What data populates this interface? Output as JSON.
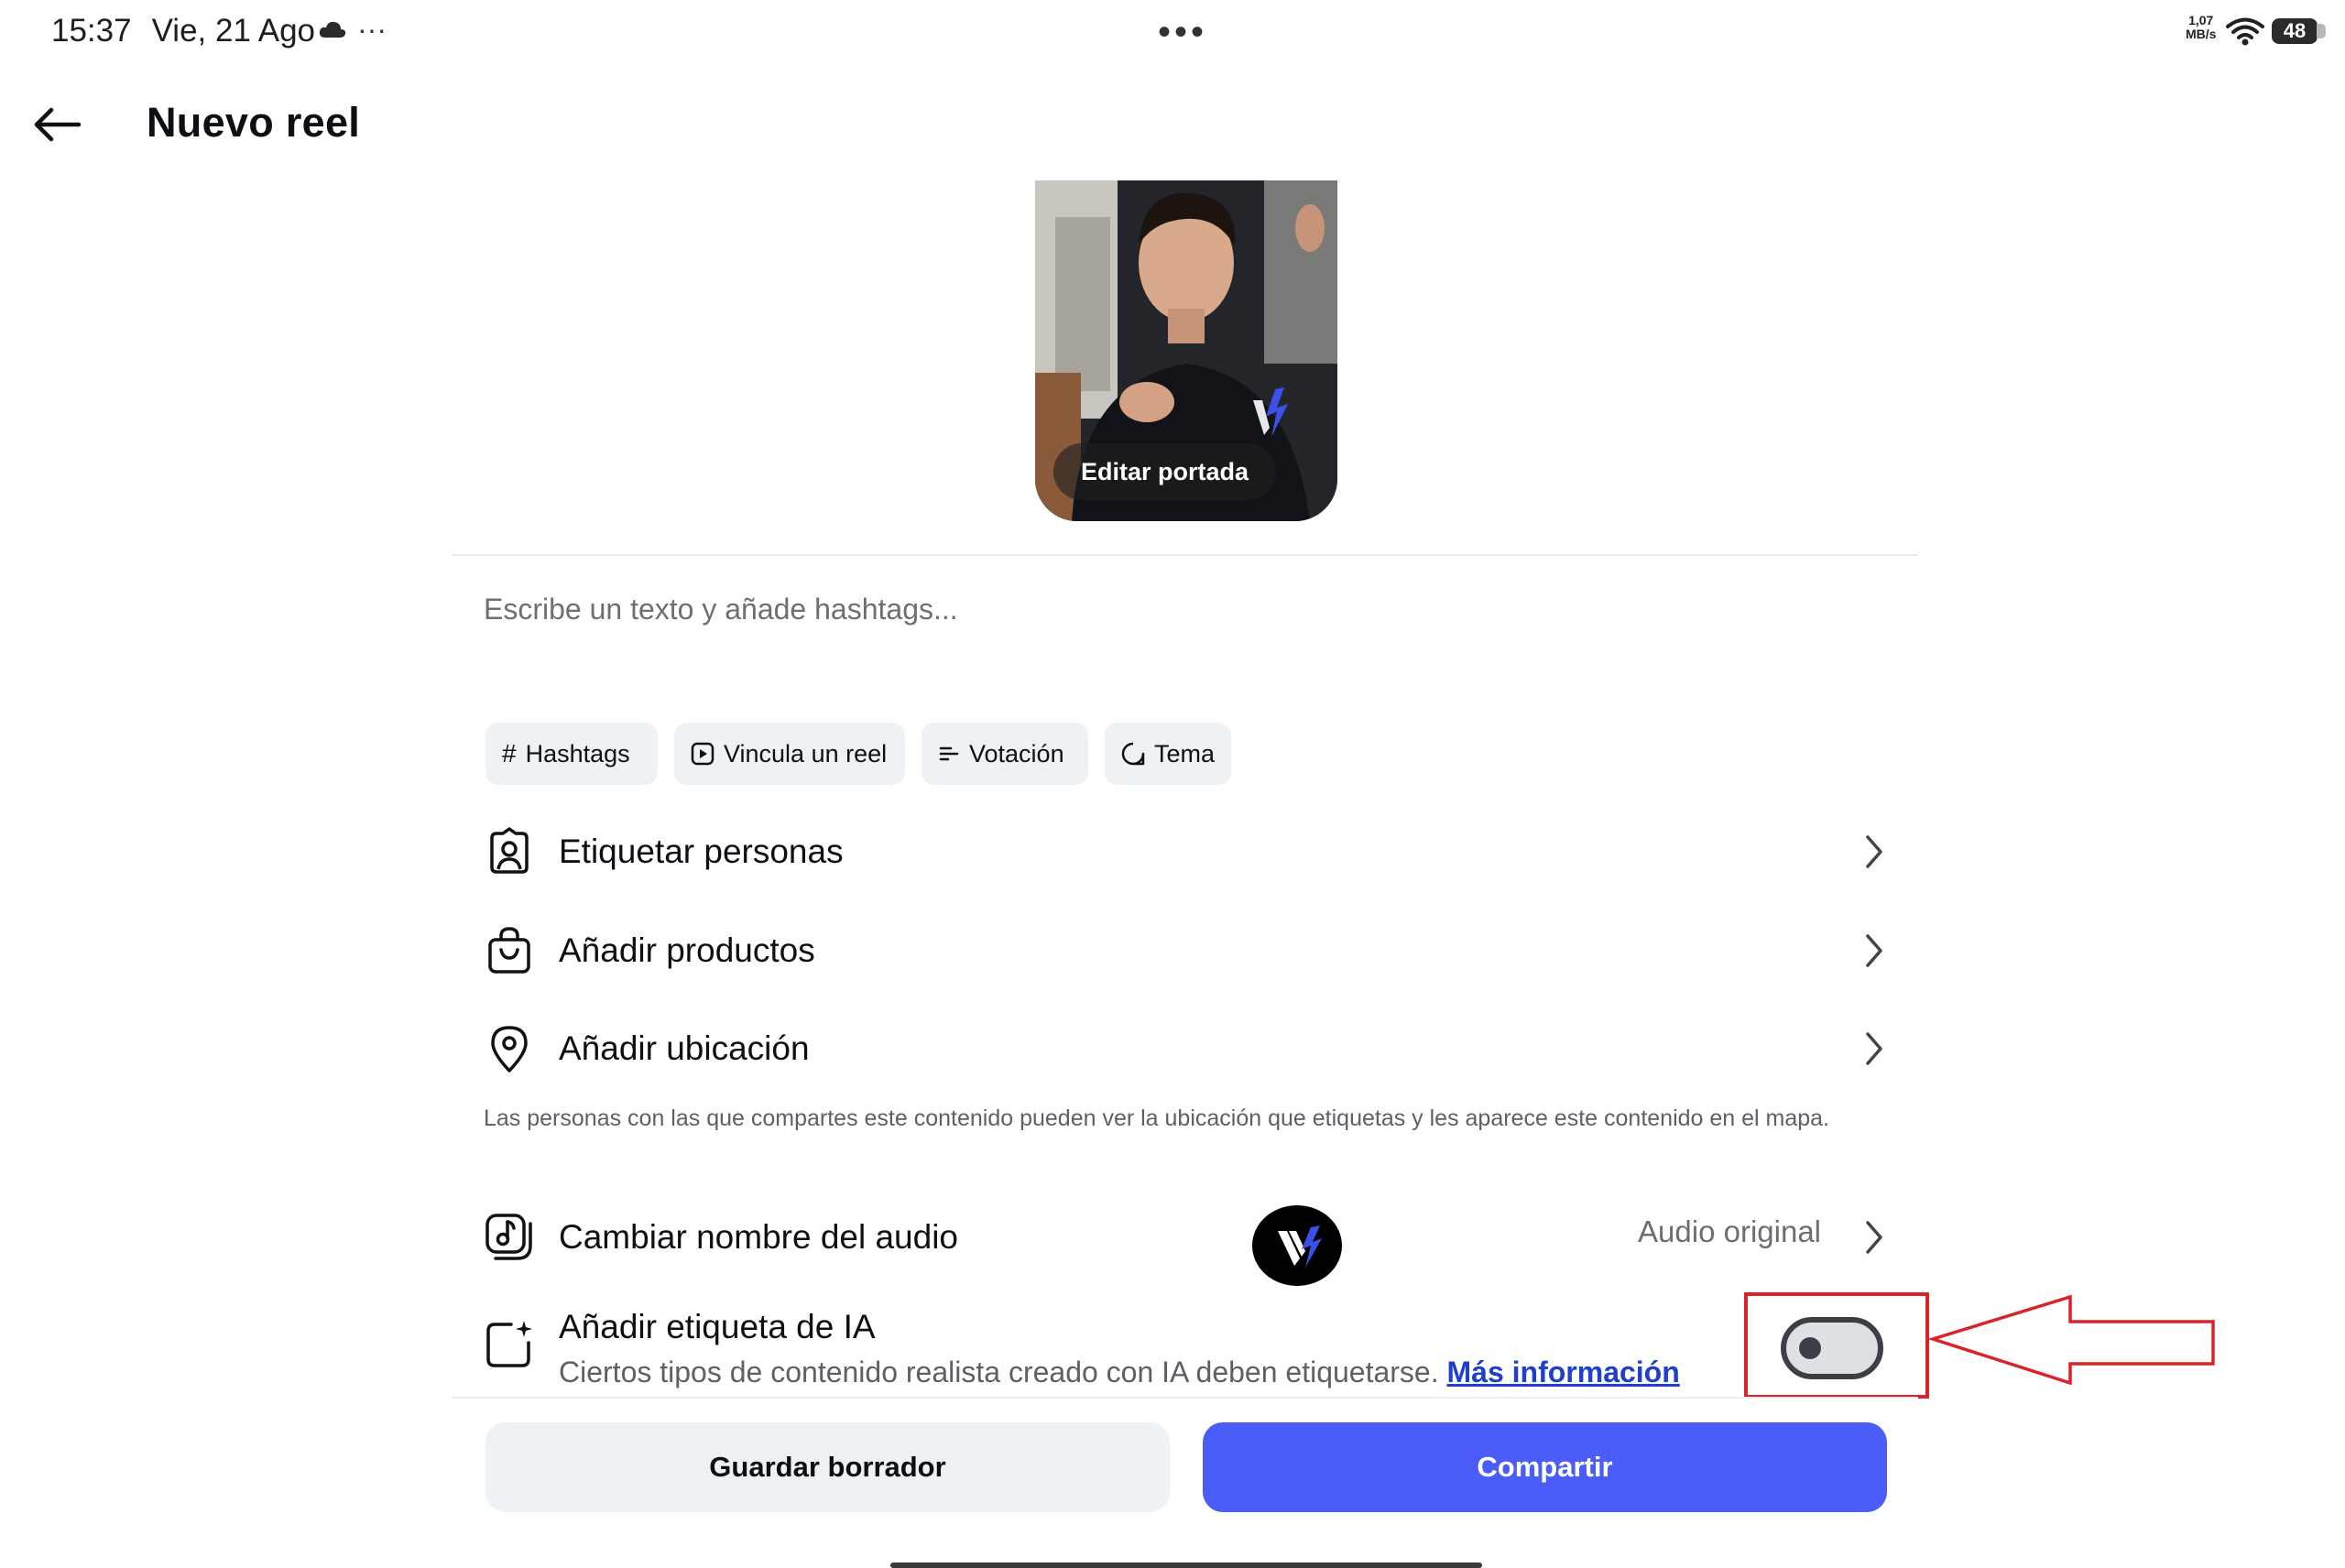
{
  "status_bar": {
    "time": "15:37",
    "date": "Vie, 21 Ago",
    "more_dots": "···",
    "center_dots": "•••",
    "network_speed_value": "1,07",
    "network_speed_unit": "MB/s",
    "battery": "48"
  },
  "header": {
    "title": "Nuevo reel",
    "back_icon": "arrow-left-icon"
  },
  "cover": {
    "edit_label": "Editar portada"
  },
  "caption": {
    "placeholder": "Escribe un texto y añade hashtags..."
  },
  "chips": [
    {
      "label": "Hashtags",
      "icon": "#"
    },
    {
      "label": "Vincula un reel",
      "icon": "reel-icon"
    },
    {
      "label": "Votación",
      "icon": "poll-icon"
    },
    {
      "label": "Tema",
      "icon": "topic-icon"
    }
  ],
  "rows": {
    "tag_people": "Etiquetar personas",
    "add_products": "Añadir productos",
    "add_location": "Añadir ubicación",
    "location_note": "Las personas con las que compartes este contenido pueden ver la ubicación que etiquetas y les aparece este contenido en el mapa.",
    "rename_audio": "Cambiar nombre del audio",
    "audio_value": "Audio original",
    "ai_label": "Añadir etiqueta de IA",
    "ai_description": "Ciertos tipos de contenido realista creado con IA deben etiquetarse.",
    "ai_more_info": "Más información",
    "ai_toggle_on": false
  },
  "actions": {
    "save_draft": "Guardar borrador",
    "share": "Compartir"
  },
  "colors": {
    "share_button": "#4a5df9",
    "link": "#1f3fcf",
    "annotation": "#d8232a"
  }
}
